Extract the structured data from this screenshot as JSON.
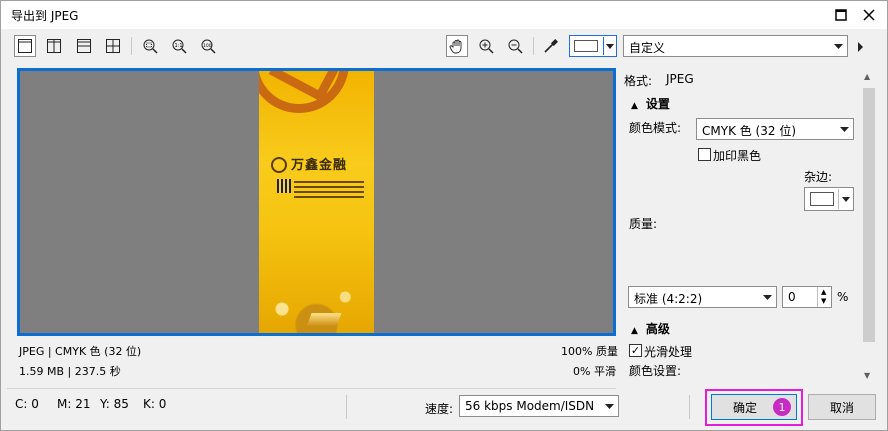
{
  "window": {
    "title": "导出到 JPEG"
  },
  "toolbar": {
    "preset": "自定义",
    "icons": [
      "single-view-icon",
      "split-vertical-icon",
      "split-horizontal-icon",
      "quad-view-icon",
      "zoom-fit-icon",
      "zoom-1to1-icon",
      "zoom-100-icon",
      "hand-pan-icon",
      "zoom-in-icon",
      "zoom-out-icon",
      "eyedropper-icon"
    ]
  },
  "preview": {
    "brand_text": "万鑫金融",
    "status_left": [
      "JPEG | CMYK 色 (32 位)",
      "1.59 MB | 237.5 秒"
    ],
    "status_right": [
      "100% 质量",
      "0% 平滑"
    ]
  },
  "settings": {
    "format_label": "格式:",
    "format_value": "JPEG",
    "section_settings": "设置",
    "color_mode_label": "颜色模式:",
    "color_mode_value": "CMYK 色 (32 位)",
    "overprint_black": "加印黑色",
    "matte_label": "杂边:",
    "quality_label": "质量:",
    "subsampling_value": "标准 (4:2:2)",
    "quality_value": "0",
    "percent": "%",
    "section_advanced": "高级",
    "smoothing_label": "光滑处理",
    "color_settings_label": "颜色设置:"
  },
  "bottom": {
    "c": "C: 0",
    "m": "M: 21",
    "y": "Y: 85",
    "k": "K: 0",
    "speed_label": "速度:",
    "speed_value": "56 kbps Modem/ISDN",
    "ok": "确定",
    "cancel": "取消",
    "badge": "1"
  },
  "colors": {
    "accent": "#0a6fd1",
    "highlight": "#e11fd8",
    "badge": "#c62bc3"
  }
}
